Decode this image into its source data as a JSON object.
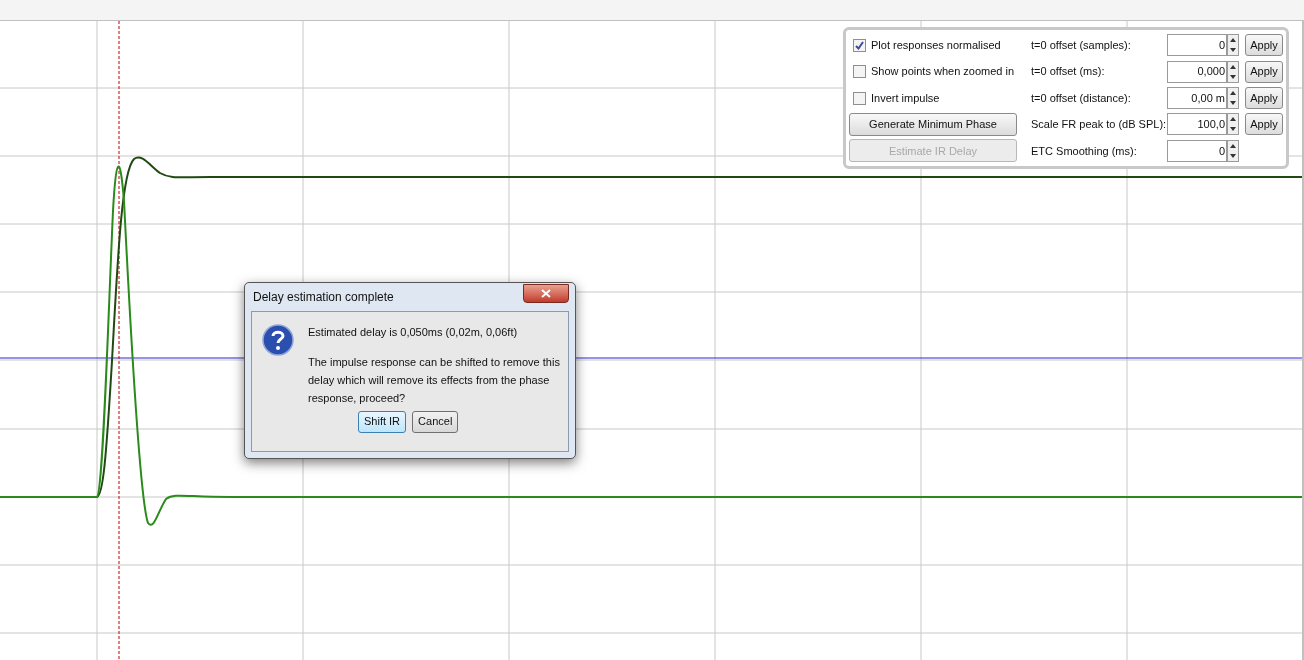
{
  "options_panel": {
    "checkboxes": [
      {
        "label": "Plot responses normalised",
        "checked": true
      },
      {
        "label": "Show points when zoomed in",
        "checked": false
      },
      {
        "label": "Invert impulse",
        "checked": false
      }
    ],
    "buttons": [
      {
        "label": "Generate Minimum Phase",
        "disabled": false
      },
      {
        "label": "Estimate IR Delay",
        "disabled": true
      }
    ],
    "fields": [
      {
        "label": "t=0 offset (samples):",
        "value": "0",
        "apply": "Apply"
      },
      {
        "label": "t=0 offset (ms):",
        "value": "0,000",
        "apply": "Apply"
      },
      {
        "label": "t=0 offset (distance):",
        "value": "0,00 m",
        "apply": "Apply"
      },
      {
        "label": "Scale FR peak to (dB SPL):",
        "value": "100,0",
        "apply": "Apply"
      },
      {
        "label": "ETC Smoothing (ms):",
        "value": "0"
      }
    ]
  },
  "dialog": {
    "title": "Delay estimation complete",
    "message": "Estimated delay is 0,050ms (0,02m, 0,06ft)",
    "detail": "The impulse response can be shifted to remove this delay which will remove its effects from the phase response, proceed?",
    "buttons": [
      {
        "label": "Shift IR",
        "focused": true
      },
      {
        "label": "Cancel",
        "focused": false
      }
    ]
  }
}
